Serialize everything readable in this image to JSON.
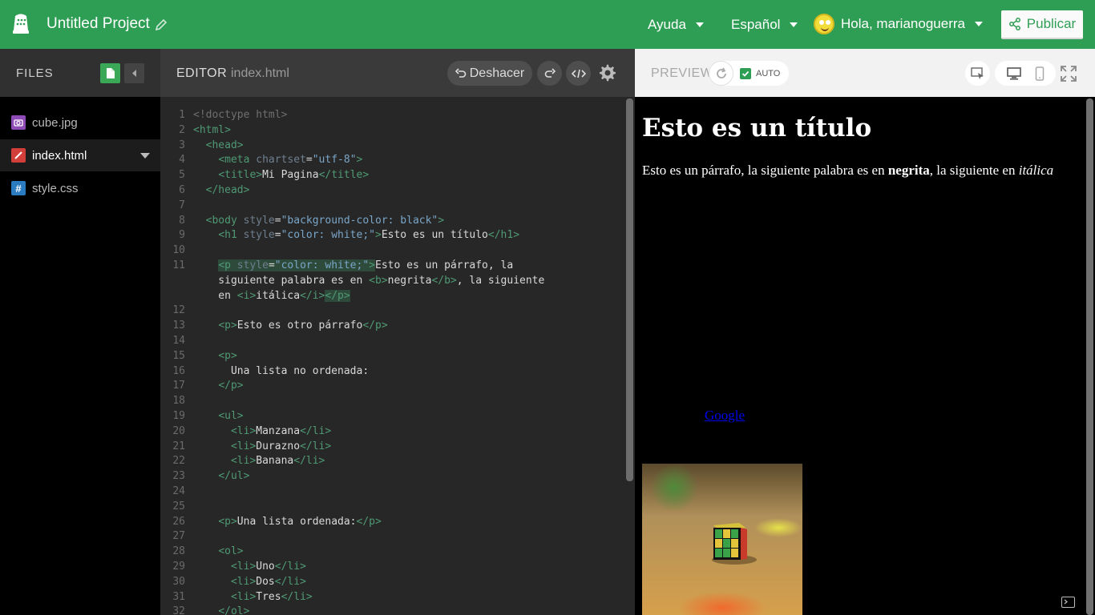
{
  "topbar": {
    "project_title": "Untitled Project",
    "help_label": "Ayuda",
    "language_label": "Español",
    "greeting": "Hola, marianoguerra",
    "publish_label": "Publicar"
  },
  "files": {
    "title": "FILES",
    "items": [
      {
        "name": "cube.jpg",
        "icon": "image-file-icon",
        "color": "#8e4bb5"
      },
      {
        "name": "index.html",
        "icon": "html-file-icon",
        "color": "#d23f3a"
      },
      {
        "name": "style.css",
        "icon": "css-file-icon",
        "color": "#2a7bc0"
      }
    ]
  },
  "editor": {
    "title": "EDITOR",
    "filename": "index.html",
    "undo_label": "Deshacer"
  },
  "preview": {
    "title": "PREVIEW",
    "auto_label": "AUTO",
    "heading": "Esto es un título",
    "para_start": "Esto es un párrafo, la siguiente palabra es en ",
    "para_bold": "negrita",
    "para_mid": ", la siguiente en ",
    "para_italic": "itálica",
    "link_text": "Google"
  },
  "code": [
    {
      "n": "1",
      "html": "<span class='cmt'>&lt;!doctype html&gt;</span>"
    },
    {
      "n": "2",
      "html": "<span class='tag'>&lt;html&gt;</span>"
    },
    {
      "n": "3",
      "html": "  <span class='tag'>&lt;head&gt;</span>"
    },
    {
      "n": "4",
      "html": "    <span class='tag'>&lt;meta</span> <span class='attr'>chartset</span>=<span class='str'>\"utf-8\"</span><span class='tag'>&gt;</span>"
    },
    {
      "n": "5",
      "html": "    <span class='tag'>&lt;title&gt;</span>Mi Pagina<span class='tag'>&lt;/title&gt;</span>"
    },
    {
      "n": "6",
      "html": "  <span class='tag'>&lt;/head&gt;</span>"
    },
    {
      "n": "7",
      "html": ""
    },
    {
      "n": "8",
      "html": "  <span class='tag'>&lt;body</span> <span class='attr'>style</span>=<span class='str'>\"background-color: black\"</span><span class='tag'>&gt;</span>"
    },
    {
      "n": "9",
      "html": "    <span class='tag'>&lt;h1</span> <span class='attr'>style</span>=<span class='str'>\"color: white;\"</span><span class='tag'>&gt;</span>Esto es un título<span class='tag'>&lt;/h1&gt;</span>"
    },
    {
      "n": "10",
      "html": ""
    },
    {
      "n": "11",
      "html": "    <span class='hl'><span class='tag'>&lt;p</span> <span class='attr'>style</span>=<span class='str'>\"color: white;\"</span><span class='tag'>&gt;</span></span>Esto es un párrafo, la"
    },
    {
      "n": "",
      "html": "    siguiente palabra es en <span class='tag'>&lt;b&gt;</span>negrita<span class='tag'>&lt;/b&gt;</span>, la siguiente"
    },
    {
      "n": "",
      "html": "    en <span class='tag'>&lt;i&gt;</span>itálica<span class='tag'>&lt;/i&gt;</span><span class='hl'><span class='tag'>&lt;/p&gt;</span></span>"
    },
    {
      "n": "12",
      "html": ""
    },
    {
      "n": "13",
      "html": "    <span class='tag'>&lt;p&gt;</span>Esto es otro párrafo<span class='tag'>&lt;/p&gt;</span>"
    },
    {
      "n": "14",
      "html": ""
    },
    {
      "n": "15",
      "html": "    <span class='tag'>&lt;p&gt;</span>"
    },
    {
      "n": "16",
      "html": "      Una lista no ordenada:"
    },
    {
      "n": "17",
      "html": "    <span class='tag'>&lt;/p&gt;</span>"
    },
    {
      "n": "18",
      "html": ""
    },
    {
      "n": "19",
      "html": "    <span class='tag'>&lt;ul&gt;</span>"
    },
    {
      "n": "20",
      "html": "      <span class='tag'>&lt;li&gt;</span>Manzana<span class='tag'>&lt;/li&gt;</span>"
    },
    {
      "n": "21",
      "html": "      <span class='tag'>&lt;li&gt;</span>Durazno<span class='tag'>&lt;/li&gt;</span>"
    },
    {
      "n": "22",
      "html": "      <span class='tag'>&lt;li&gt;</span>Banana<span class='tag'>&lt;/li&gt;</span>"
    },
    {
      "n": "23",
      "html": "    <span class='tag'>&lt;/ul&gt;</span>"
    },
    {
      "n": "24",
      "html": ""
    },
    {
      "n": "25",
      "html": ""
    },
    {
      "n": "26",
      "html": "    <span class='tag'>&lt;p&gt;</span>Una lista ordenada:<span class='tag'>&lt;/p&gt;</span>"
    },
    {
      "n": "27",
      "html": ""
    },
    {
      "n": "28",
      "html": "    <span class='tag'>&lt;ol&gt;</span>"
    },
    {
      "n": "29",
      "html": "      <span class='tag'>&lt;li&gt;</span>Uno<span class='tag'>&lt;/li&gt;</span>"
    },
    {
      "n": "30",
      "html": "      <span class='tag'>&lt;li&gt;</span>Dos<span class='tag'>&lt;/li&gt;</span>"
    },
    {
      "n": "31",
      "html": "      <span class='tag'>&lt;li&gt;</span>Tres<span class='tag'>&lt;/li&gt;</span>"
    },
    {
      "n": "32",
      "html": "    <span class='tag'>&lt;/ol&gt;</span>"
    }
  ]
}
